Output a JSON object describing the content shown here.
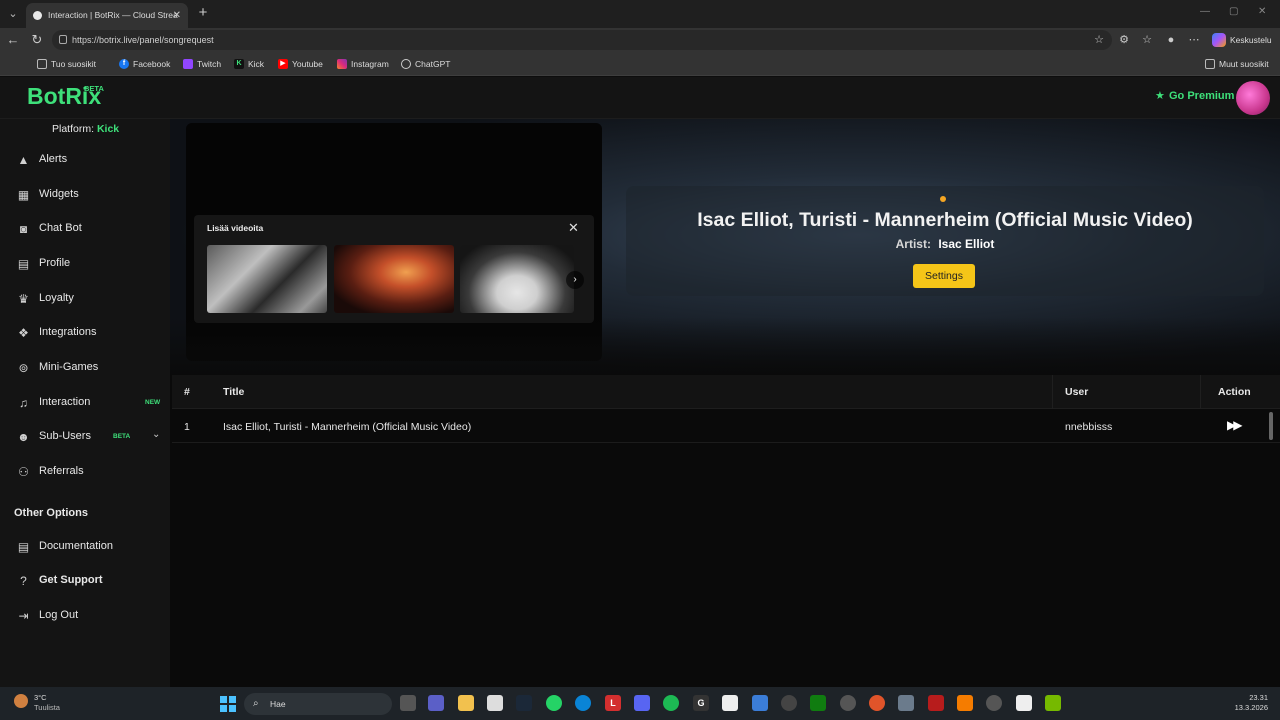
{
  "browser": {
    "tab_title": "Interaction | BotRix — Cloud Strea",
    "url": "https://botrix.live/panel/songrequest",
    "copilot_label": "Keskustelu",
    "bookmarks": [
      "Tuo suosikit",
      "Facebook",
      "Twitch",
      "Kick",
      "Youtube",
      "Instagram",
      "ChatGPT"
    ],
    "other_bookmarks": "Muut suosikit"
  },
  "app": {
    "logo": "BotRix",
    "logo_tag": "BETA",
    "premium_label": "Go Premium"
  },
  "sidebar": {
    "platform_label": "Platform:",
    "platform_value": "Kick",
    "items": [
      {
        "label": "Alerts",
        "icon": "warning-icon"
      },
      {
        "label": "Widgets",
        "icon": "widgets-icon"
      },
      {
        "label": "Chat Bot",
        "icon": "robot-icon"
      },
      {
        "label": "Profile",
        "icon": "profile-icon"
      },
      {
        "label": "Loyalty",
        "icon": "trophy-icon"
      },
      {
        "label": "Integrations",
        "icon": "integrations-icon"
      },
      {
        "label": "Mini-Games",
        "icon": "gamepad-icon"
      },
      {
        "label": "Interaction",
        "icon": "music-icon",
        "badge": "NEW"
      },
      {
        "label": "Sub-Users",
        "icon": "users-icon",
        "badge": "BETA"
      },
      {
        "label": "Referrals",
        "icon": "referrals-icon"
      }
    ],
    "other_options_title": "Other Options",
    "other_items": [
      {
        "label": "Documentation",
        "icon": "documentation-icon"
      },
      {
        "label": "Get Support",
        "icon": "question-icon"
      },
      {
        "label": "Log Out",
        "icon": "logout-icon"
      }
    ]
  },
  "player": {
    "more_videos_title": "Lisää videoita",
    "now_playing_title": "Isac Elliot, Turisti - Mannerheim (Official Music Video)",
    "artist_label": "Artist:",
    "artist_value": "Isac Elliot",
    "settings_label": "Settings"
  },
  "queue": {
    "columns": [
      "#",
      "Title",
      "User",
      "Action"
    ],
    "rows": [
      {
        "num": "1",
        "title": "Isac Elliot, Turisti - Mannerheim (Official Music Video)",
        "user": "nnebbisss"
      }
    ]
  },
  "taskbar": {
    "temperature": "3°C",
    "weather": "Tuulista",
    "search_placeholder": "Hae",
    "time": "23.31",
    "date": "13.3.2026"
  },
  "colors": {
    "accent": "#3ee07a",
    "settings_button": "#f5c518",
    "playing_dot": "#f5a623"
  }
}
